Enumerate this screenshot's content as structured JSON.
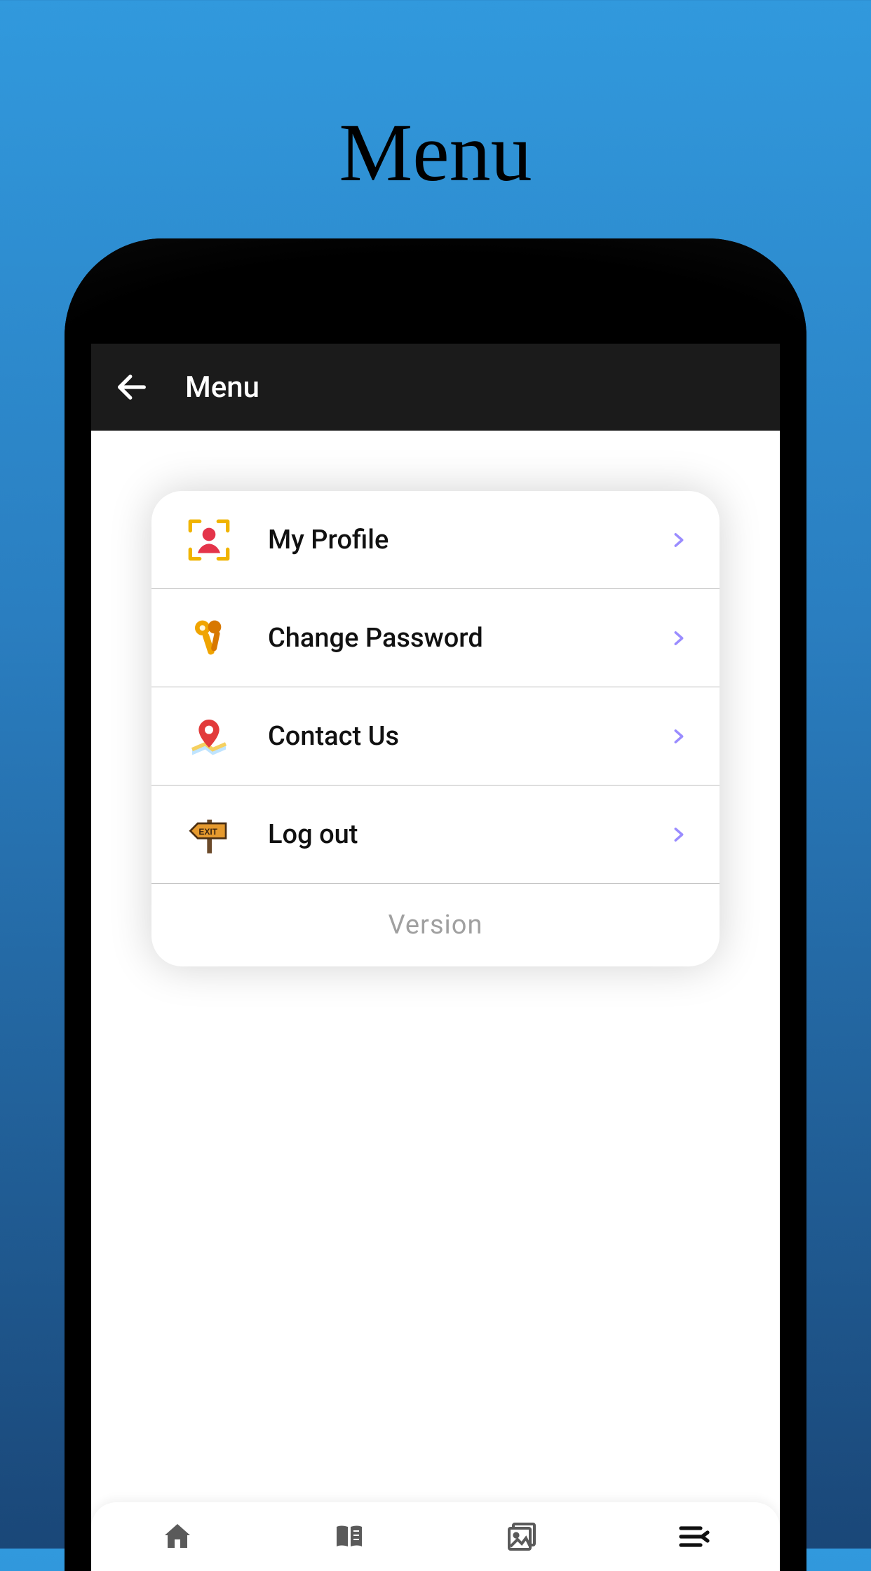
{
  "page": {
    "title": "Menu"
  },
  "appBar": {
    "title": "Menu"
  },
  "menu": {
    "items": [
      {
        "label": "My Profile",
        "icon": "profile-icon"
      },
      {
        "label": "Change Password",
        "icon": "keys-icon"
      },
      {
        "label": "Contact Us",
        "icon": "map-pin-icon"
      },
      {
        "label": "Log out",
        "icon": "exit-sign-icon"
      }
    ],
    "versionLabel": "Version"
  },
  "bottomNav": {
    "items": [
      {
        "icon": "home-icon"
      },
      {
        "icon": "book-icon"
      },
      {
        "icon": "gallery-icon"
      },
      {
        "icon": "menu-collapse-icon"
      }
    ]
  }
}
